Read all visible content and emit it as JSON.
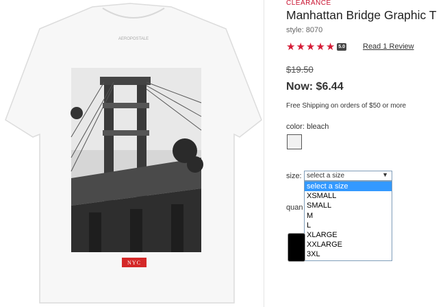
{
  "product": {
    "clearance": "CLEARANCE",
    "title": "Manhattan Bridge Graphic T",
    "style": "style: 8070",
    "rating": {
      "stars": 5,
      "score": "5.0",
      "review_link": "Read 1 Review"
    },
    "old_price": "$19.50",
    "now_price": "Now: $6.44",
    "shipping": "Free Shipping on orders of $50 or more",
    "color_label": "color: bleach",
    "swatch_color": "#f1f1f1",
    "size_label": "size:",
    "size_select": {
      "value": "select a size",
      "options": [
        "select a size",
        "XSMALL",
        "SMALL",
        "M",
        "L",
        "XLARGE",
        "XXLARGE",
        "3XL"
      ]
    },
    "quantity_label": "quan",
    "image": {
      "print_label": "NYC",
      "collar_text": "AEROPOSTALE"
    }
  },
  "colors": {
    "accent": "#c8102e",
    "stars": "#d51c36",
    "select_highlight": "#3399ff"
  }
}
